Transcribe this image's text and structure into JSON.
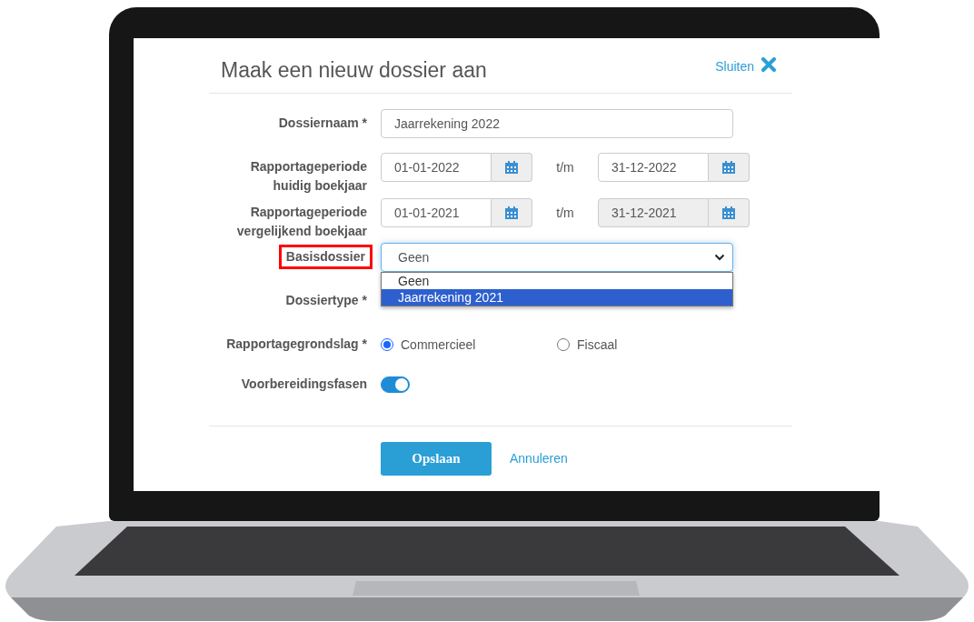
{
  "dialog": {
    "title": "Maak een nieuw dossier aan",
    "close": {
      "label": "Sluiten"
    }
  },
  "fields": [
    {
      "kind": "text",
      "label": "Dossiernaam *",
      "value": "Jaarrekening 2022"
    },
    {
      "kind": "daterange",
      "label": "Rapportageperiode huidig boekjaar",
      "from": {
        "value": "01-01-2022",
        "disabled": false
      },
      "separator": "t/m",
      "to": {
        "value": "31-12-2022",
        "disabled": false
      }
    },
    {
      "kind": "daterange",
      "label": "Rapportageperiode vergelijkend boekjaar",
      "from": {
        "value": "01-01-2021",
        "disabled": false
      },
      "separator": "t/m",
      "to": {
        "value": "31-12-2021",
        "disabled": true
      }
    },
    {
      "kind": "select",
      "label": "Basisdossier",
      "annotated": true,
      "value": "Geen",
      "expanded": true,
      "options": [
        {
          "label": "Geen",
          "highlighted": false
        },
        {
          "label": "Jaarrekening 2021",
          "highlighted": true
        }
      ]
    },
    {
      "kind": "covered",
      "label": "Dossiertype *"
    },
    {
      "kind": "radio",
      "label": "Rapportagegrondslag *",
      "options": [
        {
          "label": "Commercieel",
          "selected": true
        },
        {
          "label": "Fiscaal",
          "selected": false
        }
      ]
    },
    {
      "kind": "switch",
      "label": "Voorbereidingsfasen",
      "on": true
    }
  ],
  "buttons": [
    {
      "kind": "primary",
      "label": "Opslaan"
    },
    {
      "kind": "link",
      "label": "Annuleren"
    }
  ]
}
